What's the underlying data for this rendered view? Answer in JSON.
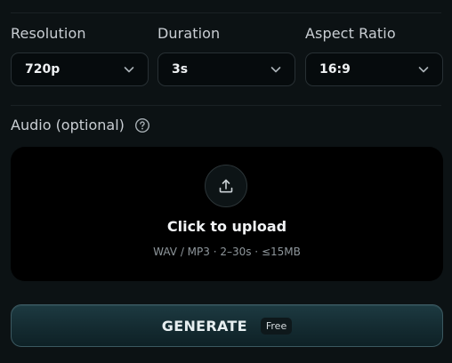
{
  "settings": {
    "resolution": {
      "label": "Resolution",
      "value": "720p"
    },
    "duration": {
      "label": "Duration",
      "value": "3s"
    },
    "aspect_ratio": {
      "label": "Aspect Ratio",
      "value": "16:9"
    }
  },
  "audio": {
    "label": "Audio (optional)",
    "upload_title": "Click to upload",
    "upload_hint": "WAV / MP3 · 2–30s · ≤15MB"
  },
  "generate": {
    "label": "GENERATE",
    "badge": "Free"
  },
  "icons": {
    "chevron": "chevron-down-icon",
    "help": "question-circle-icon",
    "upload": "upload-icon"
  },
  "colors": {
    "background": "#0c1214",
    "select_bg": "#060b0d",
    "dropzone_bg": "#000000",
    "button_accent": "#1d3a41"
  }
}
